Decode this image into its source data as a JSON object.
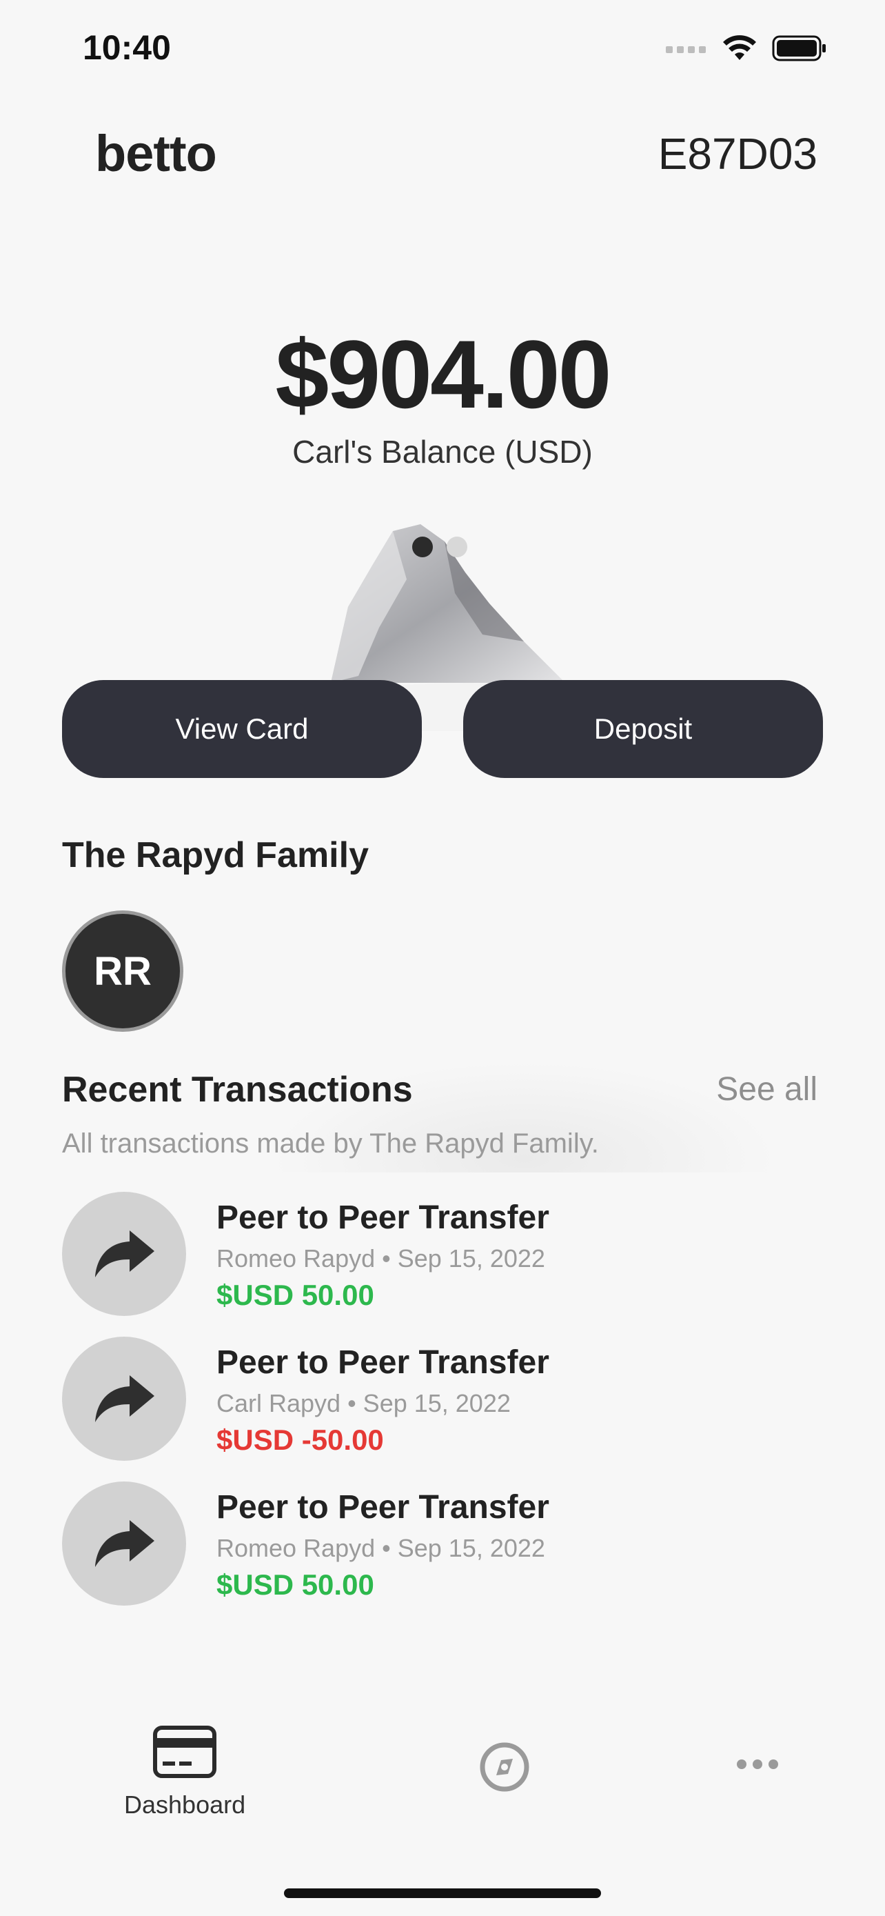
{
  "status_bar": {
    "time": "10:40"
  },
  "header": {
    "brand": "betto",
    "account_code": "E87D03"
  },
  "balance": {
    "amount": "$904.00",
    "label": "Carl's Balance (USD)"
  },
  "carousel": {
    "page_count": 2,
    "active_index": 0
  },
  "actions": {
    "view_card": "View Card",
    "deposit": "Deposit"
  },
  "family": {
    "title": "The Rapyd Family",
    "members": [
      {
        "initials": "RR"
      }
    ]
  },
  "transactions": {
    "title": "Recent Transactions",
    "see_all": "See all",
    "subtitle": "All transactions made by The Rapyd Family.",
    "items": [
      {
        "name": "Peer to Peer Transfer",
        "meta": "Romeo Rapyd • Sep 15, 2022",
        "amount": "$USD 50.00",
        "sign": "positive",
        "icon": "share-arrow-icon"
      },
      {
        "name": "Peer to Peer Transfer",
        "meta": "Carl Rapyd • Sep 15, 2022",
        "amount": "$USD -50.00",
        "sign": "negative",
        "icon": "share-arrow-icon"
      },
      {
        "name": "Peer to Peer Transfer",
        "meta": "Romeo Rapyd • Sep 15, 2022",
        "amount": "$USD 50.00",
        "sign": "positive",
        "icon": "share-arrow-icon"
      }
    ]
  },
  "tabbar": {
    "items": [
      {
        "label": "Dashboard",
        "icon": "card-icon",
        "active": true
      },
      {
        "label": "",
        "icon": "compass-icon",
        "active": false
      },
      {
        "label": "",
        "icon": "more-icon",
        "active": false
      }
    ]
  },
  "colors": {
    "button": "#31323c",
    "positive": "#2db84d",
    "negative": "#e53935",
    "background": "#f7f7f7"
  }
}
